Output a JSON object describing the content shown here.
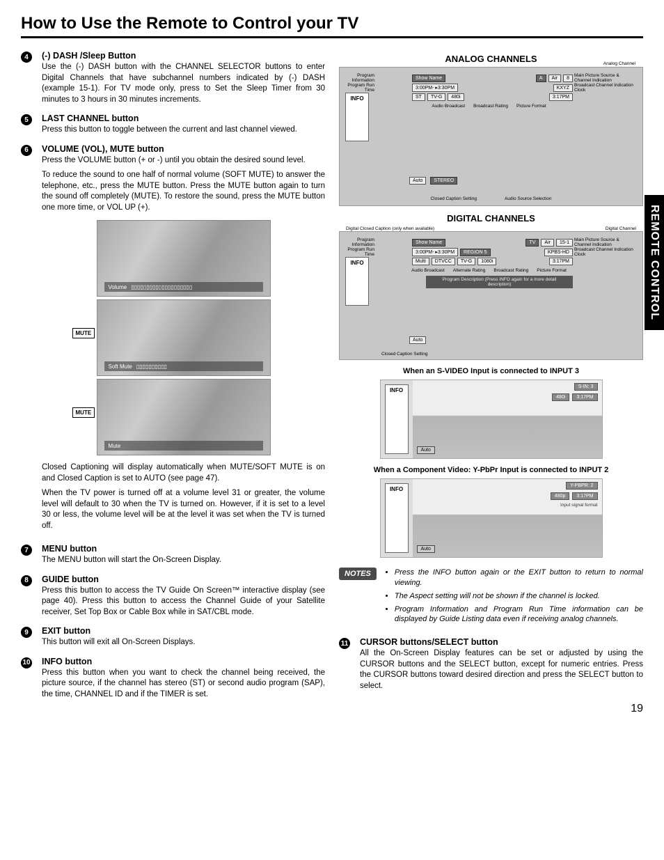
{
  "page_title": "How to Use the Remote to Control your TV",
  "side_tab": "REMOTE CONTROL",
  "page_number": "19",
  "items": {
    "n4": {
      "num": "4",
      "title": "(-) DASH /Sleep Button",
      "body": "Use the (-) DASH button with the CHANNEL SELECTOR buttons to enter Digital Channels that have subchannel numbers indicated by (-) DASH (example 15-1). For TV mode only, press to Set the Sleep Timer from 30 minutes to 3 hours in 30 minutes increments."
    },
    "n5": {
      "num": "5",
      "title": "LAST CHANNEL button",
      "body": "Press this button to toggle between the current and last channel viewed."
    },
    "n6": {
      "num": "6",
      "title": "VOLUME (VOL), MUTE button",
      "p1": "Press the VOLUME button (+ or -) until you obtain the desired sound level.",
      "p2": "To reduce the sound to one half of normal volume (SOFT MUTE) to answer the telephone, etc., press the MUTE button. Press the MUTE button again to turn the sound off completely (MUTE). To restore the sound, press the MUTE button one more time, or VOL UP (+).",
      "p3": "Closed Captioning will display automatically when MUTE/SOFT MUTE is on and Closed Caption is set to AUTO (see page 47).",
      "p4": "When the TV power is turned off at a volume level 31 or greater, the volume level will default to 30 when the TV is turned on. However, if it is set to a level 30 or less, the volume level will be at the level it was set when the TV is turned off."
    },
    "n7": {
      "num": "7",
      "title": "MENU button",
      "body": "The MENU button will start the On-Screen Display."
    },
    "n8": {
      "num": "8",
      "title": "GUIDE button",
      "body": "Press this button to access the TV Guide On Screen™ interactive display (see page 40). Press this button to access the Channel Guide of your Satellite receiver, Set Top Box or Cable Box while in SAT/CBL mode."
    },
    "n9": {
      "num": "9",
      "title": "EXIT button",
      "body": "This button will exit all On-Screen Displays."
    },
    "n10": {
      "num": "10",
      "title": "INFO button",
      "body": "Press this button when you want to check the channel being received, the picture source, if the channel has stereo (ST) or second audio program (SAP), the time, CHANNEL ID and if the TIMER is set."
    },
    "n11": {
      "num": "11",
      "title": "CURSOR buttons/SELECT button",
      "body": "All the On-Screen Display features can be set or adjusted by using the CURSOR buttons and the SELECT button, except for numeric entries. Press the CURSOR buttons toward desired direction and press the SELECT button to select."
    }
  },
  "illus": {
    "mute_label": "MUTE",
    "bar1": "Volume",
    "bar2": "Soft Mute",
    "bar3": "Mute"
  },
  "analog": {
    "title": "ANALOG CHANNELS",
    "top_right_label": "Analog Channel",
    "left_labels": "Program Information\nProgram Run Time",
    "info": "INFO",
    "right_labels": "Main Picture Source & Channel Indication\nBroadcast Channel Indication\nClock",
    "row1_show": "Show Name",
    "row1_a": "A",
    "row1_air": "Air",
    "row1_ch": "8",
    "row2_time": "3:00PM- ▸3:30PM",
    "row2_kxyz": "KXYZ",
    "row3_st": "ST",
    "row3_tvg": "TV-G",
    "row3_480i": "480i",
    "row3_clock": "3:17PM",
    "below1": "Audio Broadcast",
    "below2": "Broadcast Rating",
    "below3": "Picture Format",
    "chip_auto": "Auto",
    "chip_stereo": "STEREO",
    "bottom1": "Closed Caption Setting",
    "bottom2": "Audio Source Selection"
  },
  "digital": {
    "title": "DIGITAL CHANNELS",
    "sub_left": "Digital Closed Caption (only when available)",
    "sub_right": "Digital Channel",
    "left_labels": "Program Information\nProgram Run Time",
    "info": "INFO",
    "right_labels": "Main Picture Source & Channel Indication\nBroadcast Channel Indication\nClock",
    "row1_show": "Show Name",
    "row1_tv": "TV",
    "row1_air": "Air",
    "row1_ch": "15-1",
    "row2_time": "3:00PM- ▸3:30PM",
    "row2_region": "REGION 5",
    "row2_kpbs": "KPBS-HD",
    "row3_multi": "Multi",
    "row3_dtvcc": "DTVCC",
    "row3_tvg": "TV-G",
    "row3_1080i": "1080i",
    "row3_clock": "3:17PM",
    "below1": "Audio Broadcast",
    "below2": "Alternate Rating",
    "below3": "Broadcast Rating",
    "below4": "Picture Format",
    "prog_desc": "Program Description (Press INFO again for a more detail description)",
    "chip_auto": "Auto",
    "bottom1": "Closed Caption Setting"
  },
  "svideo": {
    "heading": "When an S-VIDEO Input is connected to INPUT 3",
    "info": "INFO",
    "label": "S-IN: 3",
    "fmt": "480i",
    "clock": "3:17PM",
    "auto": "Auto"
  },
  "component": {
    "heading": "When a Component Video: Y-PbPr Input is connected to INPUT 2",
    "info": "INFO",
    "label": "Y-PBPR: 2",
    "fmt": "480p",
    "clock": "3:17PM",
    "signal": "Input signal format",
    "auto": "Auto"
  },
  "notes": {
    "badge": "NOTES",
    "n1": "Press the INFO button again or the EXIT button to return to normal viewing.",
    "n2": "The Aspect setting will not be shown if the channel is locked.",
    "n3": "Program Information and Program Run Time information can be displayed by Guide Listing data even if receiving analog channels."
  }
}
